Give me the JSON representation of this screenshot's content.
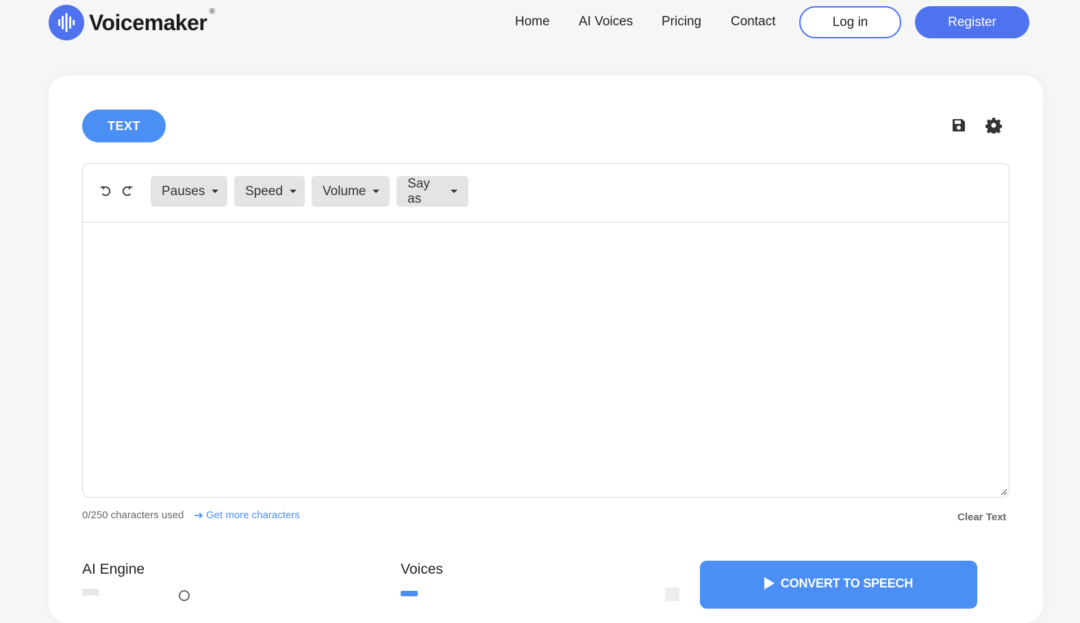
{
  "brand": {
    "name": "Voicemaker",
    "reg_mark": "®",
    "accent": "#4f73ef"
  },
  "nav": {
    "links": [
      "Home",
      "AI Voices",
      "Pricing",
      "Contact"
    ],
    "login": "Log in",
    "register": "Register"
  },
  "editor": {
    "tab": "TEXT",
    "toolbar": {
      "undo_icon": "undo-icon",
      "redo_icon": "redo-icon",
      "dropdowns": [
        "Pauses",
        "Speed",
        "Volume",
        "Say as"
      ]
    },
    "text_value": "",
    "chars_used": "0/250 characters used",
    "more_chars": "Get more characters",
    "clear": "Clear Text"
  },
  "actions": {
    "save_icon": "save-icon",
    "settings_icon": "gear-icon"
  },
  "settings": {
    "engine_label": "AI Engine",
    "voices_label": "Voices"
  },
  "convert": {
    "label": "CONVERT TO SPEECH",
    "color": "#4b8ff5"
  }
}
